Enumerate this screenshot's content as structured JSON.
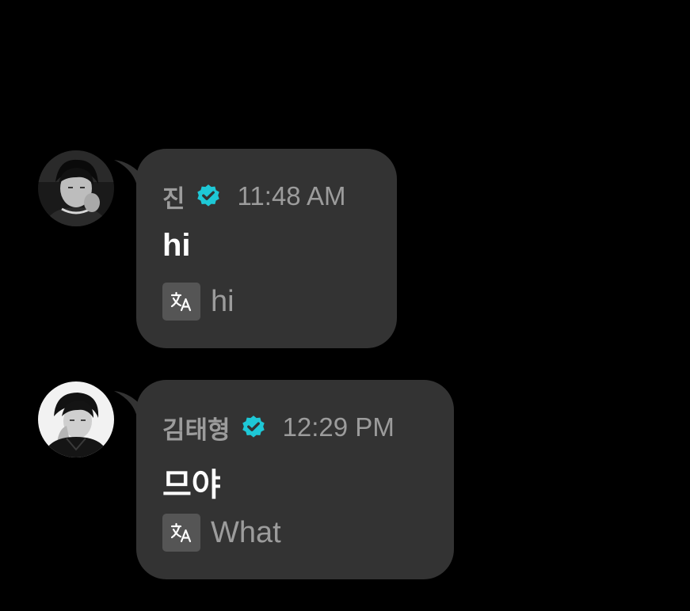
{
  "colors": {
    "background": "#000000",
    "bubble": "#333333",
    "meta_text": "#9c9c9c",
    "message_text": "#ffffff",
    "verified_badge": "#1ec8d6",
    "translate_icon_bg": "#555555"
  },
  "messages": [
    {
      "sender": "진",
      "verified": true,
      "time": "11:48 AM",
      "text": "hi",
      "translation": "hi",
      "avatar_icon": "profile-photo"
    },
    {
      "sender": "김태형",
      "verified": true,
      "time": "12:29 PM",
      "text": "므야",
      "translation": "What",
      "avatar_icon": "profile-photo"
    }
  ]
}
